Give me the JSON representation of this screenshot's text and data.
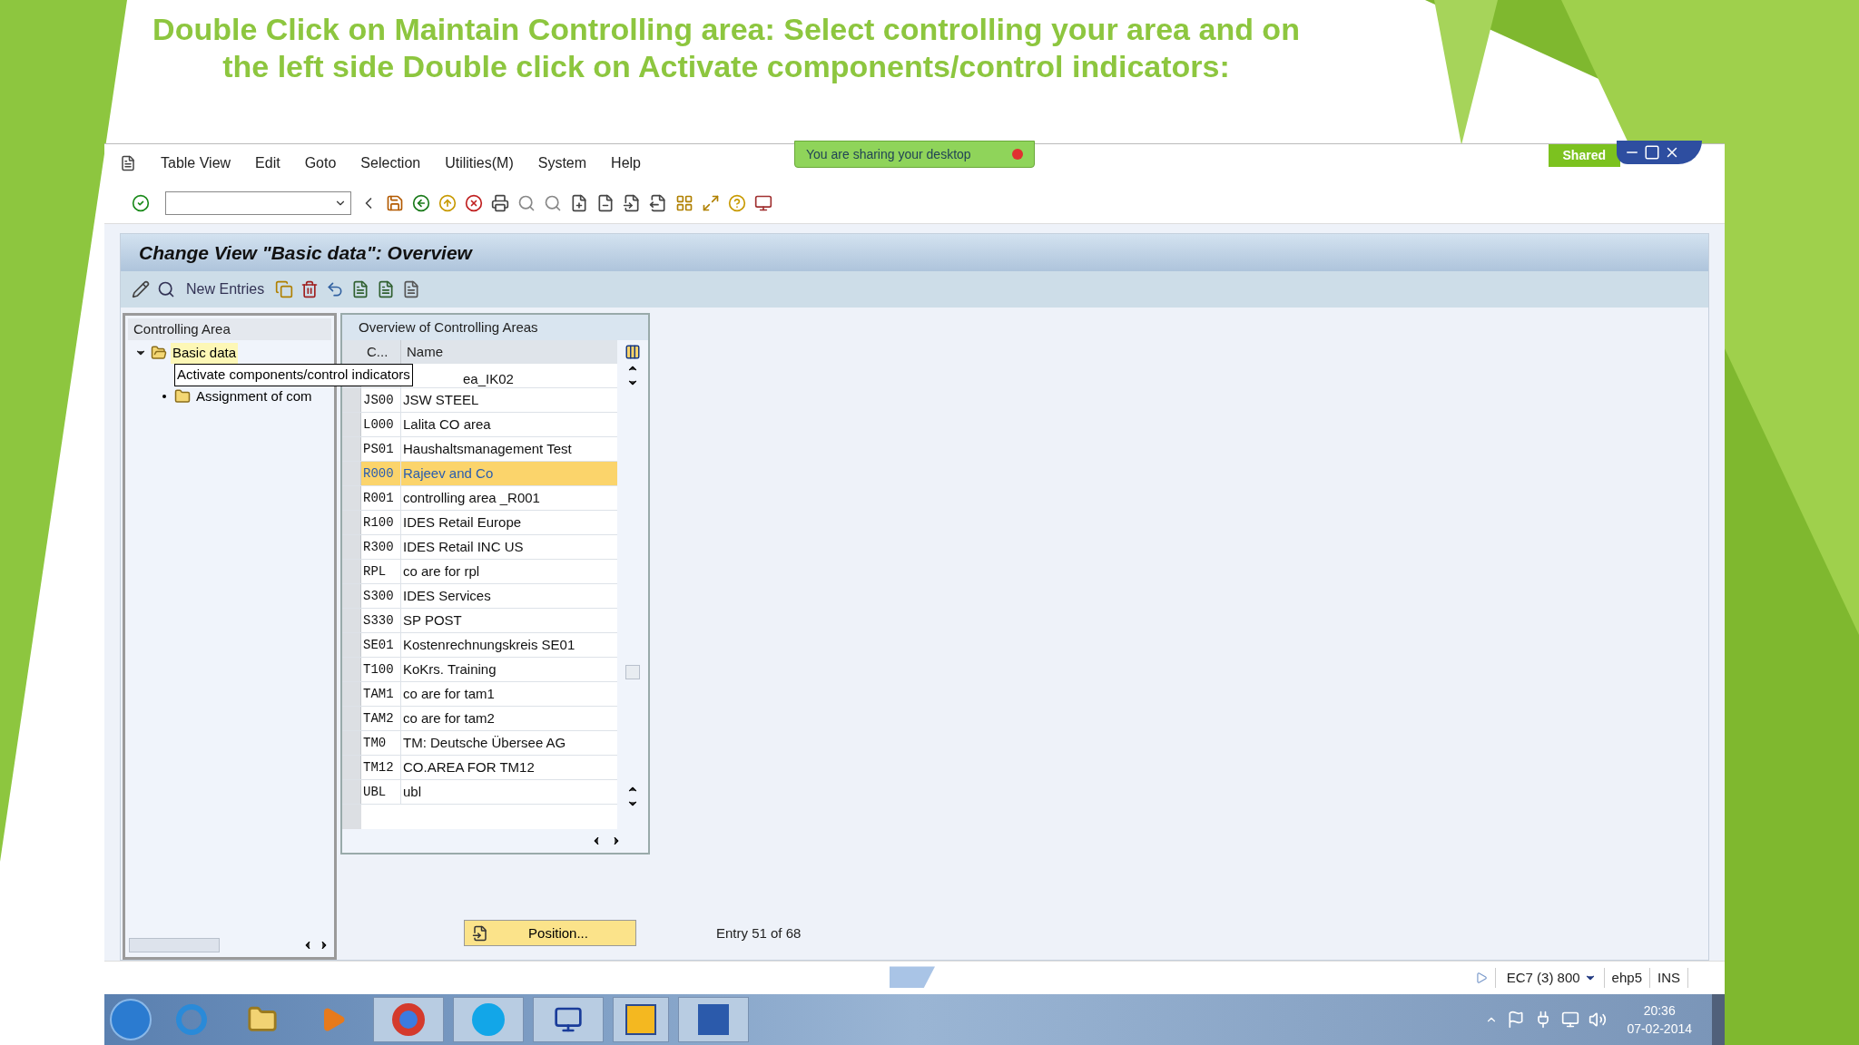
{
  "slide_title": "Double Click on Maintain Controlling area: Select controlling your area and on the left side Double click on Activate components/control indicators:",
  "sharing_banner": "You are sharing your desktop",
  "shared_badge": "Shared",
  "menu": [
    "Table View",
    "Edit",
    "Goto",
    "Selection",
    "Utilities(M)",
    "System",
    "Help"
  ],
  "screen_title": "Change View \"Basic data\": Overview",
  "new_entries": "New Entries",
  "tree": {
    "header": "Controlling Area",
    "items": [
      {
        "label": "Basic data",
        "selected": true,
        "expanded": true,
        "children": [
          {
            "label": "Activate components/control indicators",
            "tooltip": true
          },
          {
            "label": "Assignment of com",
            "tooltip": false
          }
        ]
      }
    ]
  },
  "table": {
    "title": "Overview of Controlling Areas",
    "columns": [
      "C...",
      "Name"
    ],
    "rows": [
      {
        "name": "ea_IK02",
        "selected": false
      },
      {
        "code": "JS00",
        "name": "JSW STEEL",
        "selected": false
      },
      {
        "code": "L000",
        "name": "Lalita CO area",
        "selected": false
      },
      {
        "code": "PS01",
        "name": "Haushaltsmanagement Test",
        "selected": false
      },
      {
        "code": "R000",
        "name": "Rajeev and Co",
        "selected": true
      },
      {
        "code": "R001",
        "name": "controlling area _R001",
        "selected": false
      },
      {
        "code": "R100",
        "name": "IDES Retail Europe",
        "selected": false
      },
      {
        "code": "R300",
        "name": "IDES Retail INC US",
        "selected": false
      },
      {
        "code": "RPL",
        "name": "co are for rpl",
        "selected": false
      },
      {
        "code": "S300",
        "name": "IDES Services",
        "selected": false
      },
      {
        "code": "S330",
        "name": "SP POST",
        "selected": false
      },
      {
        "code": "SE01",
        "name": "Kostenrechnungskreis SE01",
        "selected": false
      },
      {
        "code": "T100",
        "name": "KoKrs. Training",
        "selected": false
      },
      {
        "code": "TAM1",
        "name": "co are for tam1",
        "selected": false
      },
      {
        "code": "TAM2",
        "name": "co are for tam2",
        "selected": false
      },
      {
        "code": "TM0",
        "name": "TM: Deutsche Übersee AG",
        "selected": false
      },
      {
        "code": "TM12",
        "name": "CO.AREA FOR TM12",
        "selected": false
      },
      {
        "code": "UBL",
        "name": "ubl",
        "selected": false
      }
    ]
  },
  "position_button": "Position...",
  "entry_info": "Entry 51 of 68",
  "status_bar": {
    "system": "EC7 (3) 800",
    "release": "ehp5",
    "mode": "INS"
  },
  "taskbar": {
    "time": "20:36",
    "date": "07-02-2014"
  }
}
